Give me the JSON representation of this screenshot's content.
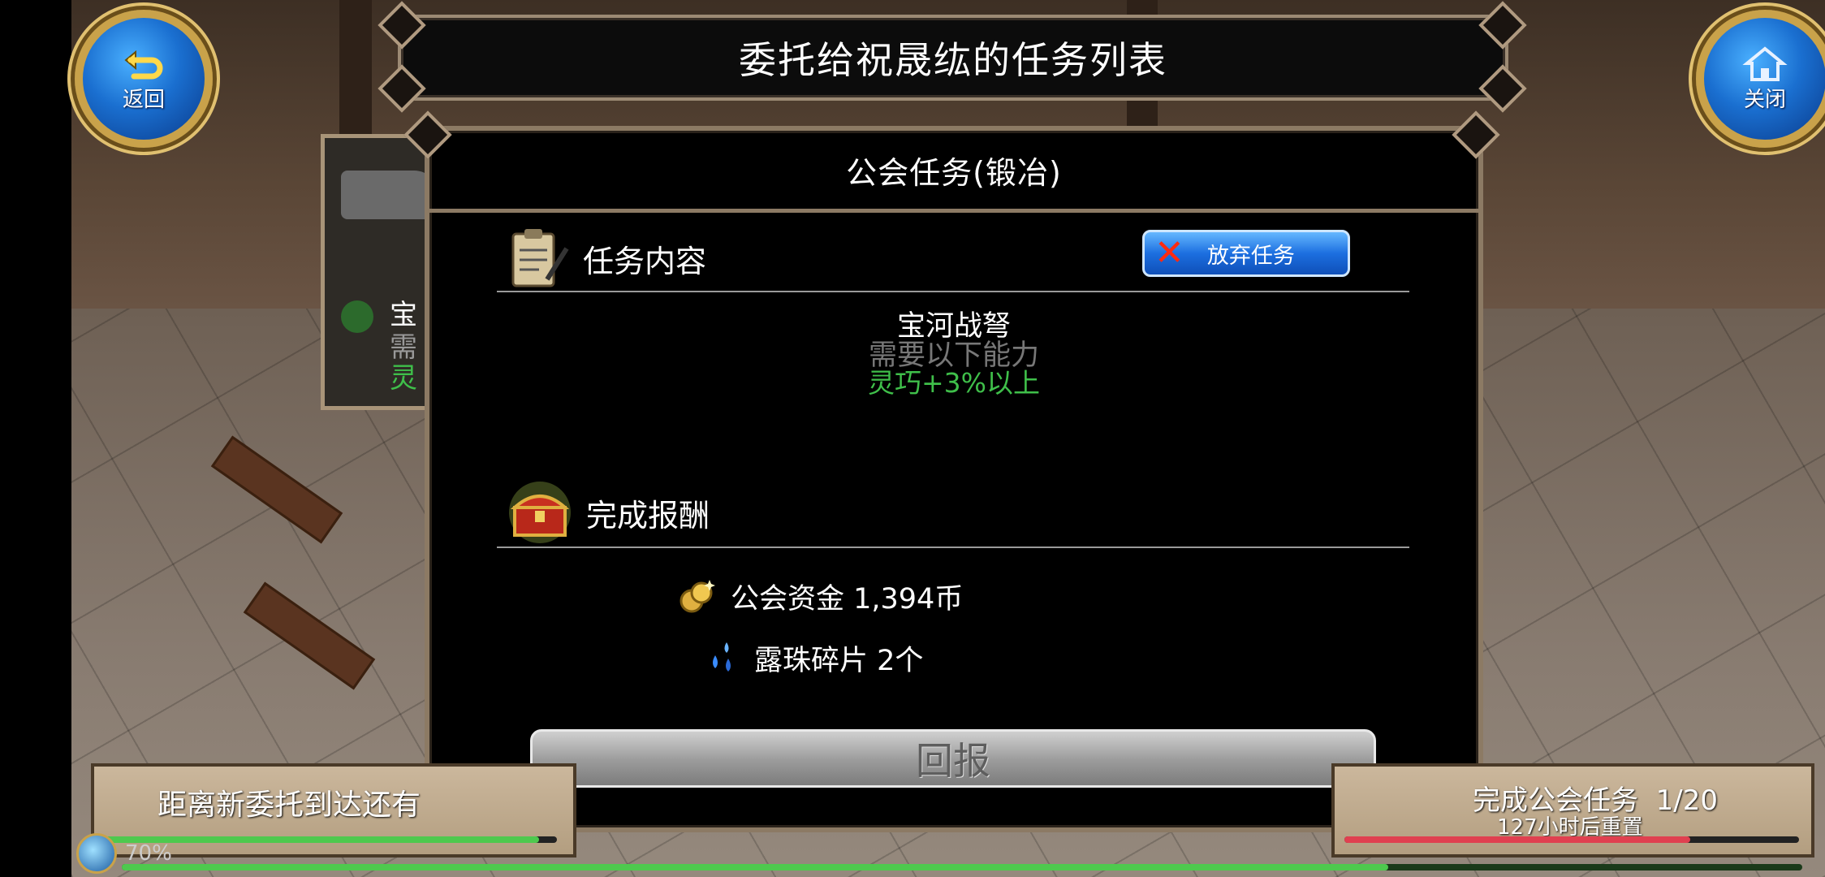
{
  "header": {
    "title": "委托给祝晟纮的任务列表"
  },
  "nav": {
    "back_label": "返回",
    "close_label": "关闭"
  },
  "side_card": {
    "line1": "宝",
    "line2": "需",
    "line3": "灵"
  },
  "modal": {
    "title": "公会任务(锻冶)",
    "content_heading": "任务内容",
    "abandon_label": "放弃任务",
    "task_name": "宝河战弩",
    "requirement_label": "需要以下能力",
    "requirement_value": "灵巧+3%以上",
    "reward_heading": "完成报酬",
    "rewards": [
      {
        "icon": "coins-icon",
        "text": "公会资金 1,394币"
      },
      {
        "icon": "dew-shard-icon",
        "text": "露珠碎片 2个"
      }
    ],
    "report_label": "回报"
  },
  "bottom_left": {
    "text": "距离新委托到达还有",
    "percent_text": "70%",
    "progress": 0.96
  },
  "bottom_right": {
    "text": "完成公会任务  1/20",
    "subtext": "127小时后重置",
    "progress": 0.76
  },
  "colors": {
    "accent_blue": "#1c6fe0",
    "req_green": "#3fbf4a",
    "gold_frame": "#c9a24a"
  }
}
